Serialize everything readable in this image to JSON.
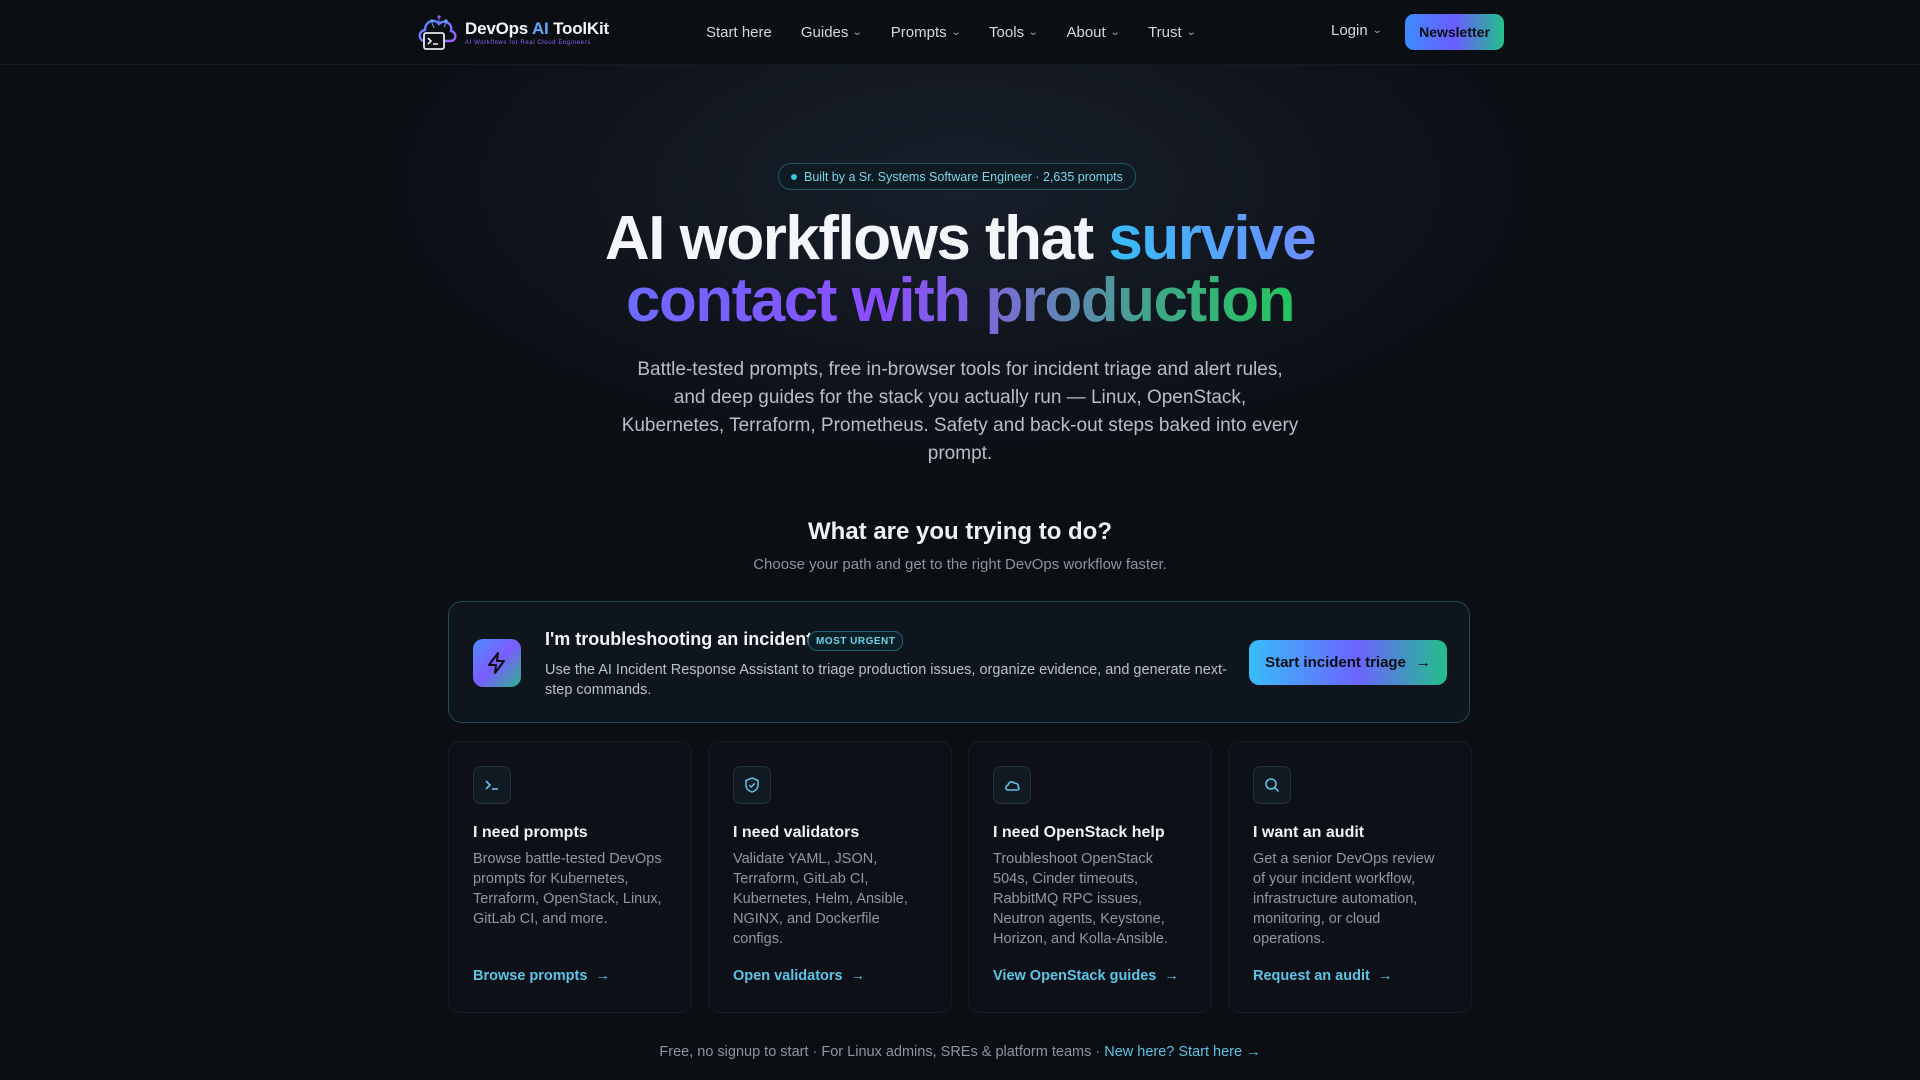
{
  "colors": {
    "background": "#0b0e13",
    "accent_cyan": "#38bdf8",
    "accent_purple": "#8b4dff",
    "accent_green": "#22c55e",
    "link": "#5cc4e6"
  },
  "nav": {
    "logo": {
      "title_prefix": "DevOps ",
      "title_ai": "AI",
      "title_suffix": " ToolKit",
      "subtitle": "AI Workflows for Real Cloud Engineers",
      "icon": "cloud-terminal-logo-icon"
    },
    "links": [
      {
        "label": "Start here",
        "has_dropdown": false
      },
      {
        "label": "Guides",
        "has_dropdown": true
      },
      {
        "label": "Prompts",
        "has_dropdown": true
      },
      {
        "label": "Tools",
        "has_dropdown": true
      },
      {
        "label": "About",
        "has_dropdown": true
      },
      {
        "label": "Trust",
        "has_dropdown": true
      }
    ],
    "login_label": "Login",
    "newsletter_label": "Newsletter"
  },
  "hero": {
    "badge": "Built by a Sr. Systems Software Engineer · 2,635 prompts",
    "title_part1": "AI workflows that ",
    "title_part2": "survive",
    "title_part3": "contact with production",
    "description": "Battle-tested prompts, free in-browser tools for incident triage and alert rules, and deep guides for the stack you actually run — Linux, OpenStack, Kubernetes, Terraform, Prometheus. Safety and back-out steps baked into every prompt."
  },
  "paths": {
    "title": "What are you trying to do?",
    "subtitle": "Choose your path and get to the right DevOps workflow faster."
  },
  "incident": {
    "icon": "lightning-icon",
    "title": "I'm troubleshooting an incident",
    "badge": "MOST URGENT",
    "description": "Use the AI Incident Response Assistant to triage production issues, organize evidence, and generate next-step commands.",
    "button_label": "Start incident triage"
  },
  "cards": [
    {
      "icon": "terminal-icon",
      "title": "I need prompts",
      "description": "Browse battle-tested DevOps prompts for Kubernetes, Terraform, OpenStack, Linux, GitLab CI, and more.",
      "link": "Browse prompts"
    },
    {
      "icon": "shield-check-icon",
      "title": "I need validators",
      "description": "Validate YAML, JSON, Terraform, GitLab CI, Kubernetes, Helm, Ansible, NGINX, and Dockerfile configs.",
      "link": "Open validators"
    },
    {
      "icon": "cloud-icon",
      "title": "I need OpenStack help",
      "description": "Troubleshoot OpenStack 504s, Cinder timeouts, RabbitMQ RPC issues, Neutron agents, Keystone, Horizon, and Kolla-Ansible.",
      "link": "View OpenStack guides"
    },
    {
      "icon": "search-icon",
      "title": "I want an audit",
      "description": "Get a senior DevOps review of your incident workflow, infrastructure automation, monitoring, or cloud operations.",
      "link": "Request an audit"
    }
  ],
  "footer": {
    "text": "Free, no signup to start · For Linux admins, SREs & platform teams · ",
    "link": "New here? Start here →"
  }
}
